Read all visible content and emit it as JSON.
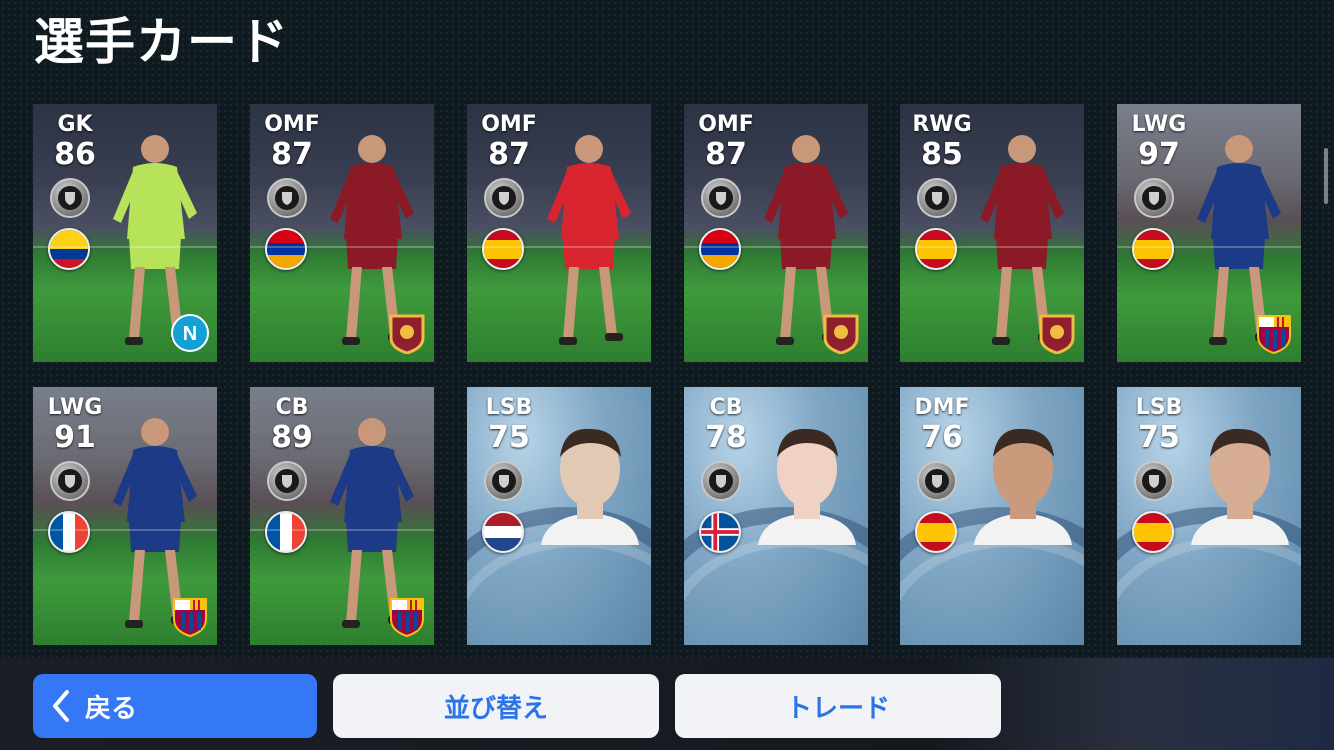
{
  "header": {
    "title": "選手カード"
  },
  "cards": [
    {
      "position": "GK",
      "rating": "86",
      "flag": "colombia",
      "club": "napoli",
      "style": "stadium",
      "kit": "#b6e35a"
    },
    {
      "position": "OMF",
      "rating": "87",
      "flag": "armenia",
      "club": "roma",
      "style": "stadium",
      "kit": "#8c1a26"
    },
    {
      "position": "OMF",
      "rating": "87",
      "flag": "spain",
      "club": "",
      "style": "stadium",
      "kit": "#d8252f"
    },
    {
      "position": "OMF",
      "rating": "87",
      "flag": "armenia",
      "club": "roma",
      "style": "stadium",
      "kit": "#8c1a26"
    },
    {
      "position": "RWG",
      "rating": "85",
      "flag": "spain",
      "club": "roma",
      "style": "stadium",
      "kit": "#8c1a26"
    },
    {
      "position": "LWG",
      "rating": "97",
      "flag": "spain",
      "club": "barcelona",
      "style": "stadium light",
      "kit": "#1c3a86"
    },
    {
      "position": "LWG",
      "rating": "91",
      "flag": "france",
      "club": "barcelona",
      "style": "stadium light",
      "kit": "#1c3a86"
    },
    {
      "position": "CB",
      "rating": "89",
      "flag": "france",
      "club": "barcelona",
      "style": "stadium light",
      "kit": "#1c3a86"
    },
    {
      "position": "LSB",
      "rating": "75",
      "flag": "netherlands",
      "club": "",
      "style": "face",
      "kit": "#e2c9b4"
    },
    {
      "position": "CB",
      "rating": "78",
      "flag": "iceland",
      "club": "",
      "style": "face",
      "kit": "#f0d2c4"
    },
    {
      "position": "DMF",
      "rating": "76",
      "flag": "spain",
      "club": "",
      "style": "face",
      "kit": "#c99a7c"
    },
    {
      "position": "LSB",
      "rating": "75",
      "flag": "spain",
      "club": "",
      "style": "face",
      "kit": "#d6ad92"
    }
  ],
  "footer": {
    "back_label": "戻る",
    "sort_label": "並び替え",
    "trade_label": "トレード"
  },
  "colors": {
    "primary_button": "#3478f6",
    "secondary_button": "#f2f3f6",
    "secondary_text": "#2a74e8"
  },
  "icons": {
    "back": "chevron-left-icon",
    "badge": "shield-badge-icon"
  }
}
